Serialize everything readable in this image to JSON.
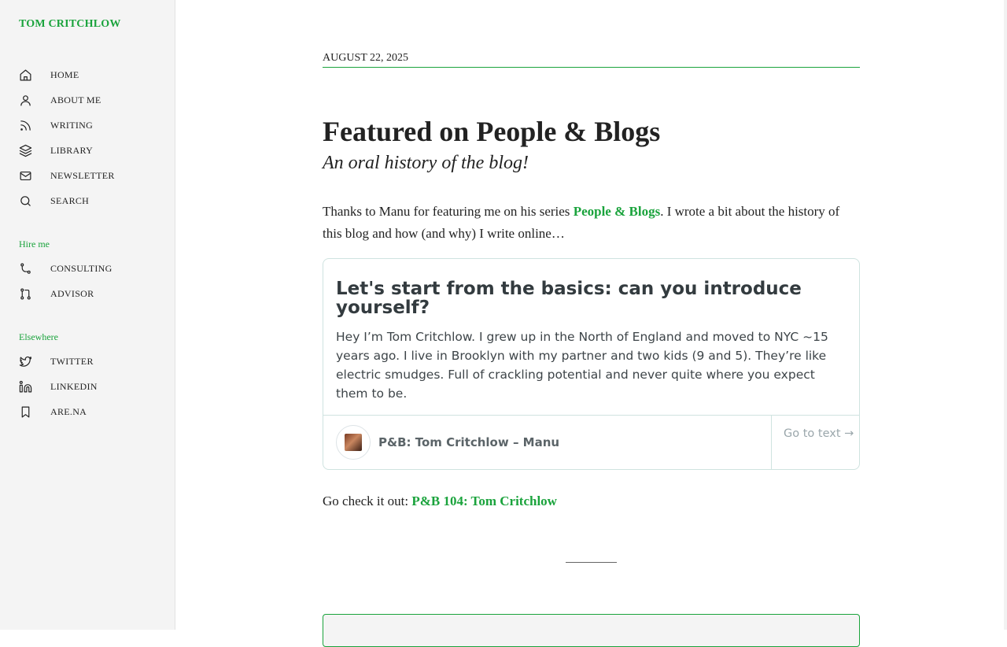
{
  "site": {
    "title": "TOM CRITCHLOW"
  },
  "nav": [
    {
      "label": "HOME",
      "icon": "home-icon"
    },
    {
      "label": "ABOUT ME",
      "icon": "user-icon"
    },
    {
      "label": "WRITING",
      "icon": "rss-icon"
    },
    {
      "label": "LIBRARY",
      "icon": "layers-icon"
    },
    {
      "label": "NEWSLETTER",
      "icon": "mail-icon"
    },
    {
      "label": "SEARCH",
      "icon": "search-icon"
    }
  ],
  "hire": {
    "label": "Hire me",
    "items": [
      {
        "label": "CONSULTING",
        "icon": "git-branch-icon"
      },
      {
        "label": "ADVISOR",
        "icon": "git-pull-request-icon"
      }
    ]
  },
  "elsewhere": {
    "label": "Elsewhere",
    "items": [
      {
        "label": "TWITTER",
        "icon": "twitter-icon"
      },
      {
        "label": "LINKEDIN",
        "icon": "linkedin-icon"
      },
      {
        "label": "ARE.NA",
        "icon": "bookmark-icon"
      }
    ]
  },
  "post": {
    "date": "AUGUST 22, 2025",
    "title": "Featured on People & Blogs",
    "subtitle": "An oral history of the blog!",
    "intro_before": "Thanks to Manu for featuring me on his series ",
    "intro_link": "People & Blogs",
    "intro_after": ". I wrote a bit about the history of this blog and how (and why) I write online…",
    "card": {
      "heading": "Let's start from the basics: can you introduce yourself?",
      "text": "Hey I’m Tom Critchlow. I grew up in the North of England and moved to NYC ~15 years ago. I live in Brooklyn with my partner and two kids (9 and 5). They’re like electric smudges. Full of crackling potential and never quite where you expect them to be.",
      "source": "P&B: Tom Critchlow – Manu",
      "goto": "Go to text →"
    },
    "after_text": "Go check it out: ",
    "after_link": "P&B 104: Tom Critchlow"
  },
  "colors": {
    "accent": "#1aa33c",
    "sidebar_bg": "#f4f4f4",
    "card_border": "#cfe3e0"
  }
}
